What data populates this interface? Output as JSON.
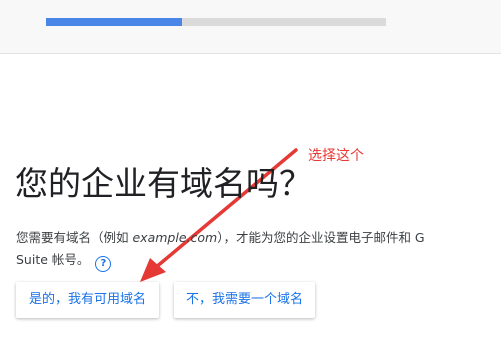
{
  "progress": {
    "fraction": 0.4
  },
  "annotation": {
    "text": "选择这个"
  },
  "main": {
    "question": "您的企业有域名吗？",
    "description_part1": "您需要有域名（例如 ",
    "description_example": "example.com",
    "description_part2": "），才能为您的企业设置电子邮件和 G Suite 帐号。",
    "help_icon_glyph": "?"
  },
  "buttons": {
    "yes_label": "是的，我有可用域名",
    "no_label": "不，我需要一个域名"
  },
  "colors": {
    "accent": "#1a73e8",
    "progress": "#4a86e8",
    "annotation": "#e53935"
  },
  "icons": [
    "help-circle-icon",
    "arrow-annotation-icon"
  ]
}
